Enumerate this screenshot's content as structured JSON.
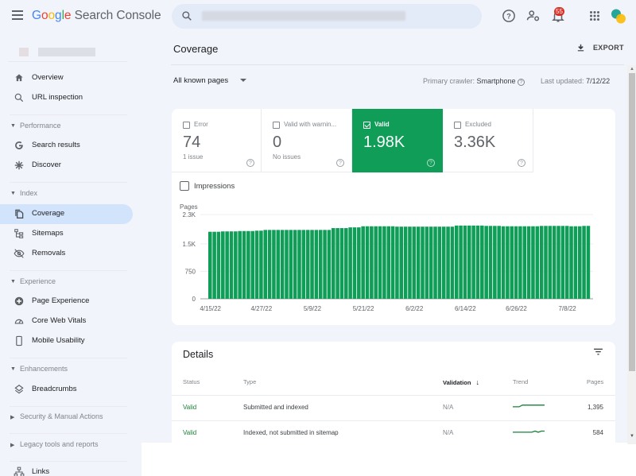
{
  "header": {
    "app_name_google": "Google",
    "app_name_rest": " Search Console",
    "search_placeholder": "",
    "notifications_count": "55",
    "icons": [
      "menu-icon",
      "search-icon",
      "help-icon",
      "manage-users-icon",
      "notifications-icon",
      "apps-icon",
      "account-avatar"
    ]
  },
  "sidebar": {
    "top_items": [
      {
        "label": "Overview",
        "icon": "home-icon"
      },
      {
        "label": "URL inspection",
        "icon": "search-icon"
      }
    ],
    "sections": [
      {
        "label": "Performance",
        "expanded": true,
        "items": [
          {
            "label": "Search results",
            "icon": "google-g-icon"
          },
          {
            "label": "Discover",
            "icon": "asterisk-icon"
          }
        ]
      },
      {
        "label": "Index",
        "expanded": true,
        "items": [
          {
            "label": "Coverage",
            "icon": "coverage-icon",
            "active": true
          },
          {
            "label": "Sitemaps",
            "icon": "sitemap-icon"
          },
          {
            "label": "Removals",
            "icon": "eye-off-icon"
          }
        ]
      },
      {
        "label": "Experience",
        "expanded": true,
        "items": [
          {
            "label": "Page Experience",
            "icon": "page-experience-icon"
          },
          {
            "label": "Core Web Vitals",
            "icon": "gauge-icon"
          },
          {
            "label": "Mobile Usability",
            "icon": "phone-icon"
          }
        ]
      },
      {
        "label": "Enhancements",
        "expanded": true,
        "items": [
          {
            "label": "Breadcrumbs",
            "icon": "layers-icon"
          }
        ]
      },
      {
        "label": "Security & Manual Actions",
        "expanded": false,
        "items": []
      },
      {
        "label": "Legacy tools and reports",
        "expanded": false,
        "items": []
      }
    ],
    "bottom_items": [
      {
        "label": "Links",
        "icon": "links-icon"
      }
    ]
  },
  "main": {
    "title": "Coverage",
    "export_label": "EXPORT",
    "filter_value": "All known pages",
    "crawler_label": "Primary crawler:",
    "crawler_value": "Smartphone",
    "updated_label": "Last updated:",
    "updated_value": "7/12/22",
    "tiles": [
      {
        "label": "Error",
        "value": "74",
        "sub": "1 issue",
        "checked": false
      },
      {
        "label": "Valid with warnin...",
        "value": "0",
        "sub": "No issues",
        "checked": false
      },
      {
        "label": "Valid",
        "value": "1.98K",
        "sub": "",
        "checked": true
      },
      {
        "label": "Excluded",
        "value": "3.36K",
        "sub": "",
        "checked": false
      }
    ],
    "impressions_label": "Impressions",
    "impressions_checked": false
  },
  "chart_data": {
    "type": "bar",
    "title": "",
    "ylabel": "Pages",
    "xlabel": "",
    "ylim": [
      0,
      2300
    ],
    "yticks": [
      0,
      750,
      1500,
      2300
    ],
    "ytick_labels": [
      "0",
      "750",
      "1.5K",
      "2.3K"
    ],
    "xtick_labels": [
      "4/15/22",
      "4/27/22",
      "5/9/22",
      "5/21/22",
      "6/2/22",
      "6/14/22",
      "6/26/22",
      "7/8/22"
    ],
    "xtick_indices": [
      0,
      12,
      24,
      36,
      48,
      60,
      72,
      84
    ],
    "start_date": "4/15/22",
    "end_date": "7/12/22",
    "color": "#0f9d58",
    "grid": true,
    "series": [
      {
        "name": "Valid",
        "values": [
          1830,
          1830,
          1830,
          1840,
          1840,
          1840,
          1840,
          1850,
          1850,
          1850,
          1850,
          1860,
          1860,
          1880,
          1880,
          1880,
          1880,
          1880,
          1880,
          1880,
          1880,
          1880,
          1880,
          1880,
          1880,
          1880,
          1880,
          1880,
          1880,
          1930,
          1930,
          1930,
          1930,
          1950,
          1950,
          1950,
          1980,
          1980,
          1980,
          1980,
          1980,
          1980,
          1980,
          1980,
          1970,
          1970,
          1970,
          1970,
          1970,
          1970,
          1970,
          1970,
          1970,
          1970,
          1970,
          1970,
          1970,
          1970,
          2000,
          2000,
          2000,
          2000,
          2000,
          2000,
          2000,
          1990,
          1990,
          1990,
          1990,
          1980,
          1980,
          1980,
          1980,
          1980,
          1980,
          1980,
          1980,
          1980,
          1990,
          1990,
          1990,
          1990,
          1990,
          1990,
          1990,
          1980,
          1980,
          1980,
          1990,
          1990
        ]
      }
    ]
  },
  "details": {
    "title": "Details",
    "columns": [
      "Status",
      "Type",
      "Validation",
      "Trend",
      "Pages"
    ],
    "sort_column": "Validation",
    "rows": [
      {
        "status": "Valid",
        "type": "Submitted and indexed",
        "validation": "N/A",
        "pages": "1,395",
        "trend": [
          0.3,
          0.3,
          0.3,
          0.6,
          0.6,
          0.6,
          0.6,
          0.6,
          0.6,
          0.6,
          0.6
        ]
      },
      {
        "status": "Valid",
        "type": "Indexed, not submitted in sitemap",
        "validation": "N/A",
        "pages": "584",
        "trend": [
          0.3,
          0.3,
          0.3,
          0.3,
          0.3,
          0.3,
          0.3,
          0.5,
          0.3,
          0.5,
          0.5
        ]
      }
    ]
  }
}
